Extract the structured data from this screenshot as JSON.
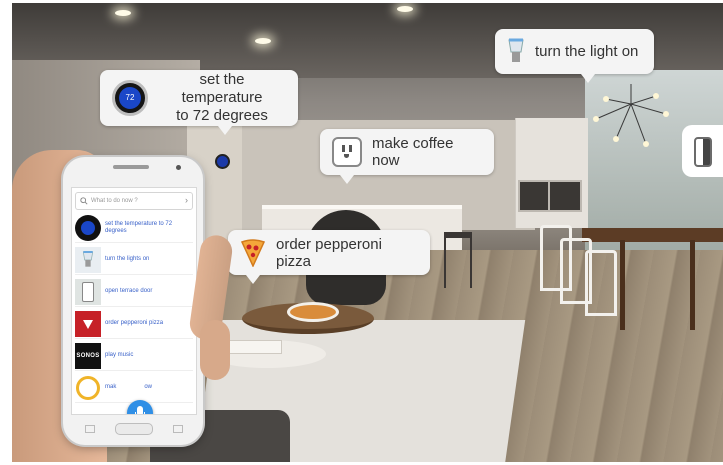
{
  "bubbles": {
    "thermostat": {
      "line1": "set the temperature",
      "line2": "to 72 degrees",
      "icon": "thermostat-icon",
      "display_value": "72"
    },
    "light": {
      "text": "turn the light on",
      "icon": "lightbulb-icon"
    },
    "coffee": {
      "text": "make coffee now",
      "icon": "smart-plug-icon"
    },
    "pizza": {
      "text": "order pepperoni pizza",
      "icon": "pizza-icon"
    }
  },
  "phone": {
    "search_placeholder": "What to do now ?",
    "items": [
      {
        "label": "set the temperature to 72 degrees",
        "icon": "thermostat-icon"
      },
      {
        "label": "turn the lights on",
        "icon": "lightbulb-icon"
      },
      {
        "label": "open terrace door",
        "icon": "door-icon"
      },
      {
        "label": "order pepperoni pizza",
        "icon": "pizza-logo-icon"
      },
      {
        "label": "play music",
        "icon": "sonos-icon",
        "icon_text": "SONOS"
      },
      {
        "label": "mak",
        "label_tail": "ow",
        "icon": "ring-icon"
      }
    ],
    "mic_icon": "microphone-icon"
  },
  "colors": {
    "link_blue": "#3a62c9",
    "mic_blue": "#2f8fe6",
    "nest_blue": "#1a47c8",
    "pizza_red": "#c62127"
  }
}
